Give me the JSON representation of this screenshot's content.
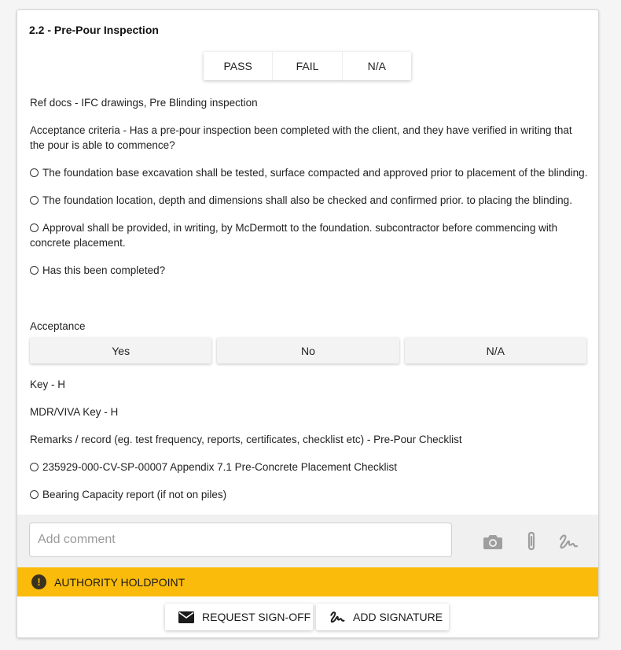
{
  "section": {
    "title": "2.2 - Pre-Pour Inspection"
  },
  "result_toggle": {
    "pass": "PASS",
    "fail": "FAIL",
    "na": "N/A"
  },
  "content": {
    "ref_docs": "Ref docs - IFC drawings, Pre Blinding inspection",
    "acceptance_criteria": "Acceptance criteria - Has a pre-pour inspection been completed with the client, and they have verified in writing that the pour is able to commence?",
    "bullets": [
      "The foundation base excavation shall be tested, surface compacted and approved prior to placement of the blinding.",
      "The foundation location, depth and dimensions shall also be checked and confirmed prior. to placing the blinding.",
      "Approval shall be provided, in writing, by McDermott to the foundation. subcontractor before commencing with concrete placement.",
      "Has this been completed?"
    ]
  },
  "acceptance": {
    "label": "Acceptance",
    "options": [
      "Yes",
      "No",
      "N/A"
    ]
  },
  "details": {
    "key": "Key - H",
    "mdr_key": "MDR/VIVA Key - H",
    "remarks": "Remarks / record (eg. test frequency, reports, certificates, checklist etc) - Pre-Pour Checklist",
    "records": [
      "235929-000-CV-SP-00007 Appendix 7.1 Pre-Concrete Placement Checklist",
      "Bearing Capacity report (if not on piles)"
    ]
  },
  "comment": {
    "placeholder": "Add comment",
    "value": "",
    "tools": [
      "camera-icon",
      "paperclip-icon",
      "signature-icon"
    ]
  },
  "holdpoint": {
    "label": "AUTHORITY HOLDPOINT",
    "icon": "exclamation-circle-icon",
    "color": "#fbbb0a"
  },
  "footer": {
    "request_signoff": "REQUEST SIGN-OFF",
    "add_signature": "ADD SIGNATURE"
  }
}
